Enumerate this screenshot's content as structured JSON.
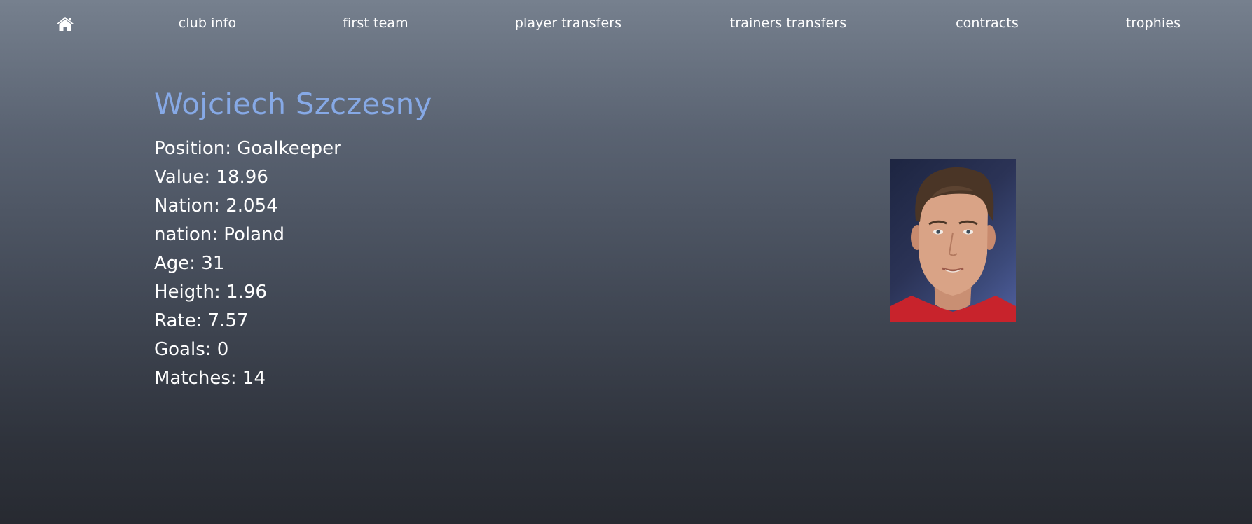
{
  "nav": {
    "home_icon": "home-icon",
    "items": [
      {
        "label": "club info"
      },
      {
        "label": "first team"
      },
      {
        "label": "player transfers"
      },
      {
        "label": "trainers transfers"
      },
      {
        "label": "contracts"
      },
      {
        "label": "trophies"
      }
    ]
  },
  "player": {
    "name": "Wojciech Szczesny",
    "stats": [
      {
        "text": "Position: Goalkeeper"
      },
      {
        "text": "Value: 18.96"
      },
      {
        "text": "Nation: 2.054"
      },
      {
        "text": "nation: Poland"
      },
      {
        "text": "Age: 31"
      },
      {
        "text": "Heigth: 1.96"
      },
      {
        "text": "Rate: 7.57"
      },
      {
        "text": "Goals: 0"
      },
      {
        "text": "Matches: 14"
      }
    ]
  },
  "colors": {
    "name_accent": "#86a9e6",
    "text": "#ffffff",
    "background_top": "#76808e",
    "background_bottom": "#272a31"
  }
}
